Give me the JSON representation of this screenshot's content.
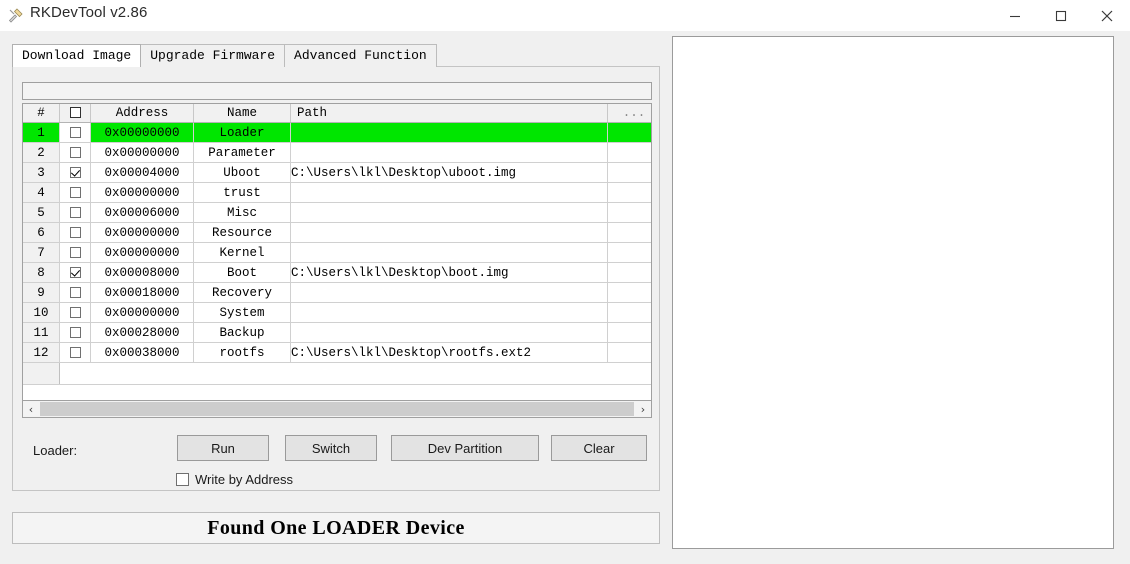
{
  "window": {
    "title": "RKDevTool v2.86",
    "icon": "tool-icon",
    "minimize_label": "–",
    "maximize_label": "□",
    "close_label": "✕"
  },
  "tabs": [
    {
      "label": "Download Image",
      "active": true
    },
    {
      "label": "Upgrade Firmware",
      "active": false
    },
    {
      "label": "Advanced Function",
      "active": false
    }
  ],
  "grid": {
    "headers": {
      "index": "#",
      "checkbox": "",
      "address": "Address",
      "name": "Name",
      "path": "Path",
      "dots": "..."
    },
    "rows": [
      {
        "index": "1",
        "checked": false,
        "address": "0x00000000",
        "name": "Loader",
        "path": "",
        "selected": true
      },
      {
        "index": "2",
        "checked": false,
        "address": "0x00000000",
        "name": "Parameter",
        "path": "",
        "selected": false
      },
      {
        "index": "3",
        "checked": true,
        "address": "0x00004000",
        "name": "Uboot",
        "path": "C:\\Users\\lkl\\Desktop\\uboot.img",
        "selected": false
      },
      {
        "index": "4",
        "checked": false,
        "address": "0x00000000",
        "name": "trust",
        "path": "",
        "selected": false
      },
      {
        "index": "5",
        "checked": false,
        "address": "0x00006000",
        "name": "Misc",
        "path": "",
        "selected": false
      },
      {
        "index": "6",
        "checked": false,
        "address": "0x00000000",
        "name": "Resource",
        "path": "",
        "selected": false
      },
      {
        "index": "7",
        "checked": false,
        "address": "0x00000000",
        "name": "Kernel",
        "path": "",
        "selected": false
      },
      {
        "index": "8",
        "checked": true,
        "address": "0x00008000",
        "name": "Boot",
        "path": "C:\\Users\\lkl\\Desktop\\boot.img",
        "selected": false
      },
      {
        "index": "9",
        "checked": false,
        "address": "0x00018000",
        "name": "Recovery",
        "path": "",
        "selected": false
      },
      {
        "index": "10",
        "checked": false,
        "address": "0x00000000",
        "name": "System",
        "path": "",
        "selected": false
      },
      {
        "index": "11",
        "checked": false,
        "address": "0x00028000",
        "name": "Backup",
        "path": "",
        "selected": false
      },
      {
        "index": "12",
        "checked": false,
        "address": "0x00038000",
        "name": "rootfs",
        "path": "C:\\Users\\lkl\\Desktop\\rootfs.ext2",
        "selected": false
      }
    ]
  },
  "scrollbar": {
    "left_arrow": "‹",
    "right_arrow": "›"
  },
  "actions": {
    "loader_label": "Loader:",
    "run": "Run",
    "switch": "Switch",
    "dev_partition": "Dev Partition",
    "clear": "Clear",
    "write_by_address": "Write by Address",
    "write_by_address_checked": false
  },
  "status": {
    "message": "Found One LOADER Device"
  },
  "log": {
    "content": ""
  },
  "colors": {
    "selected_row": "#00e600",
    "window_background": "#f0f0f0",
    "grid_background": "#ffffff"
  }
}
